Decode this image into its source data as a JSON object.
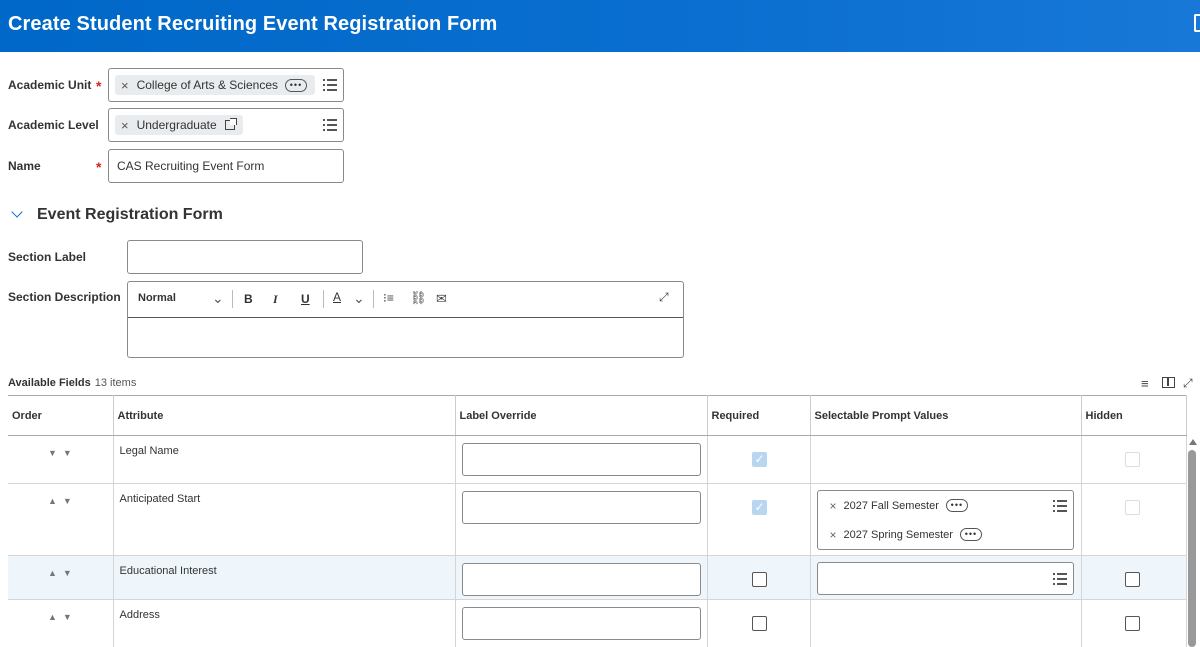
{
  "header": {
    "title": "Create Student Recruiting Event Registration Form"
  },
  "form": {
    "academic_unit": {
      "label": "Academic Unit",
      "required": "*",
      "value": "College of Arts & Sciences"
    },
    "academic_level": {
      "label": "Academic Level",
      "value": "Undergraduate"
    },
    "name": {
      "label": "Name",
      "required": "*",
      "value": "CAS Recruiting Event Form"
    }
  },
  "section": {
    "title": "Event Registration Form",
    "section_label": "Section Label",
    "section_description": "Section Description",
    "editor": {
      "style": "Normal",
      "bold": "B",
      "italic": "I",
      "underline": "U",
      "font_color": "A"
    }
  },
  "grid": {
    "title": "Available Fields",
    "count": "13 items",
    "columns": [
      "Order",
      "Attribute",
      "Label Override",
      "Required",
      "Selectable Prompt Values",
      "Hidden"
    ],
    "rows": [
      {
        "attribute": "Legal Name",
        "required": true
      },
      {
        "attribute": "Anticipated Start",
        "required": true,
        "prompts": [
          "2027 Fall Semester",
          "2027 Spring Semester"
        ]
      },
      {
        "attribute": "Educational Interest",
        "required": false
      },
      {
        "attribute": "Address",
        "required": false
      }
    ]
  },
  "colors": {
    "header_bg": "#0a6fd0",
    "required_star": "#dd2222"
  }
}
